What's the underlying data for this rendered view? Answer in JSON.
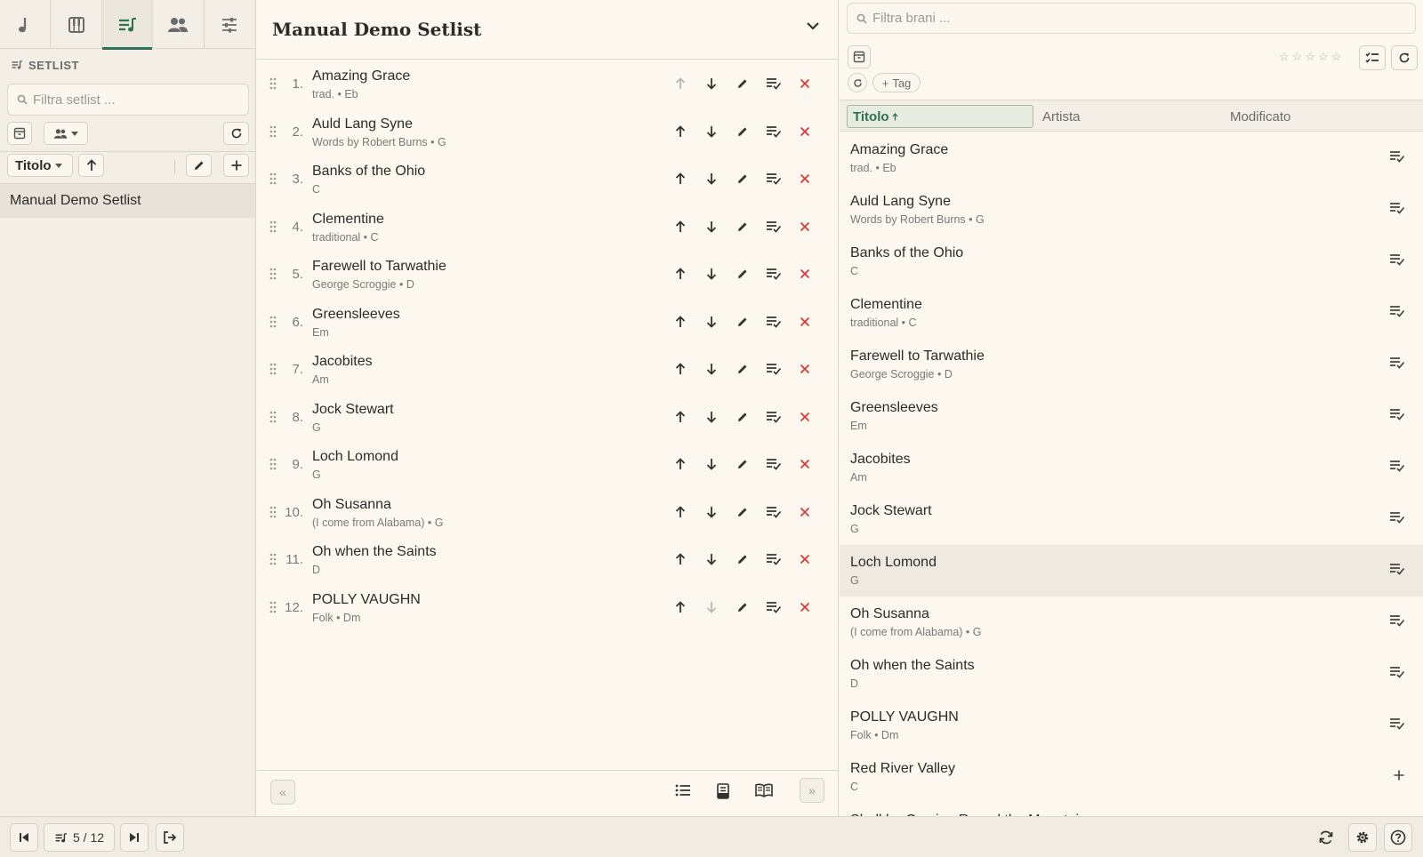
{
  "left": {
    "tabs": [
      {
        "icon": "music-note-icon"
      },
      {
        "icon": "piano-icon"
      },
      {
        "icon": "playlist-icon"
      },
      {
        "icon": "people-icon"
      },
      {
        "icon": "sliders-icon"
      }
    ],
    "section_title": "SETLIST",
    "filter_placeholder": "Filtra setlist ...",
    "sort_label": "Titolo",
    "setlists": [
      "Manual Demo Setlist"
    ]
  },
  "center": {
    "title": "Manual Demo Setlist",
    "songs": [
      {
        "num": "1.",
        "title": "Amazing Grace",
        "sub": "trad. • Eb"
      },
      {
        "num": "2.",
        "title": "Auld Lang Syne",
        "sub": "Words by Robert Burns • G"
      },
      {
        "num": "3.",
        "title": "Banks of the Ohio",
        "sub": "C"
      },
      {
        "num": "4.",
        "title": "Clementine",
        "sub": "traditional • C"
      },
      {
        "num": "5.",
        "title": "Farewell to Tarwathie",
        "sub": "George Scroggie • D"
      },
      {
        "num": "6.",
        "title": "Greensleeves",
        "sub": "Em"
      },
      {
        "num": "7.",
        "title": "Jacobites",
        "sub": "Am"
      },
      {
        "num": "8.",
        "title": "Jock Stewart",
        "sub": "G"
      },
      {
        "num": "9.",
        "title": "Loch Lomond",
        "sub": "G"
      },
      {
        "num": "10.",
        "title": "Oh Susanna",
        "sub": "(I come from Alabama) • G"
      },
      {
        "num": "11.",
        "title": "Oh when the Saints",
        "sub": "D"
      },
      {
        "num": "12.",
        "title": "POLLY VAUGHN",
        "sub": "Folk • Dm"
      }
    ]
  },
  "right": {
    "filter_placeholder": "Filtra brani ...",
    "tag_label": "Tag",
    "columns": {
      "title": "Titolo",
      "artist": "Artista",
      "modified": "Modificato"
    },
    "songs": [
      {
        "title": "Amazing Grace",
        "sub": "trad. • Eb",
        "in_setlist": true
      },
      {
        "title": "Auld Lang Syne",
        "sub": "Words by Robert Burns • G",
        "in_setlist": true
      },
      {
        "title": "Banks of the Ohio",
        "sub": "C",
        "in_setlist": true
      },
      {
        "title": "Clementine",
        "sub": "traditional • C",
        "in_setlist": true
      },
      {
        "title": "Farewell to Tarwathie",
        "sub": "George Scroggie • D",
        "in_setlist": true
      },
      {
        "title": "Greensleeves",
        "sub": "Em",
        "in_setlist": true
      },
      {
        "title": "Jacobites",
        "sub": "Am",
        "in_setlist": true
      },
      {
        "title": "Jock Stewart",
        "sub": "G",
        "in_setlist": true
      },
      {
        "title": "Loch Lomond",
        "sub": "G",
        "in_setlist": true
      },
      {
        "title": "Oh Susanna",
        "sub": "(I come from Alabama) • G",
        "in_setlist": true
      },
      {
        "title": "Oh when the Saints",
        "sub": "D",
        "in_setlist": true
      },
      {
        "title": "POLLY VAUGHN",
        "sub": "Folk • Dm",
        "in_setlist": true
      },
      {
        "title": "Red River Valley",
        "sub": "C",
        "in_setlist": false
      },
      {
        "title": "Shell be Coming Round the Mountain",
        "sub": "",
        "in_setlist": false
      }
    ],
    "highlighted_index": 8
  },
  "bottom": {
    "position": "5 / 12"
  },
  "colors": {
    "accent": "#2f6f55",
    "delete": "#d93a3a",
    "background": "#fdf8ef",
    "panel": "#f4efe6"
  }
}
